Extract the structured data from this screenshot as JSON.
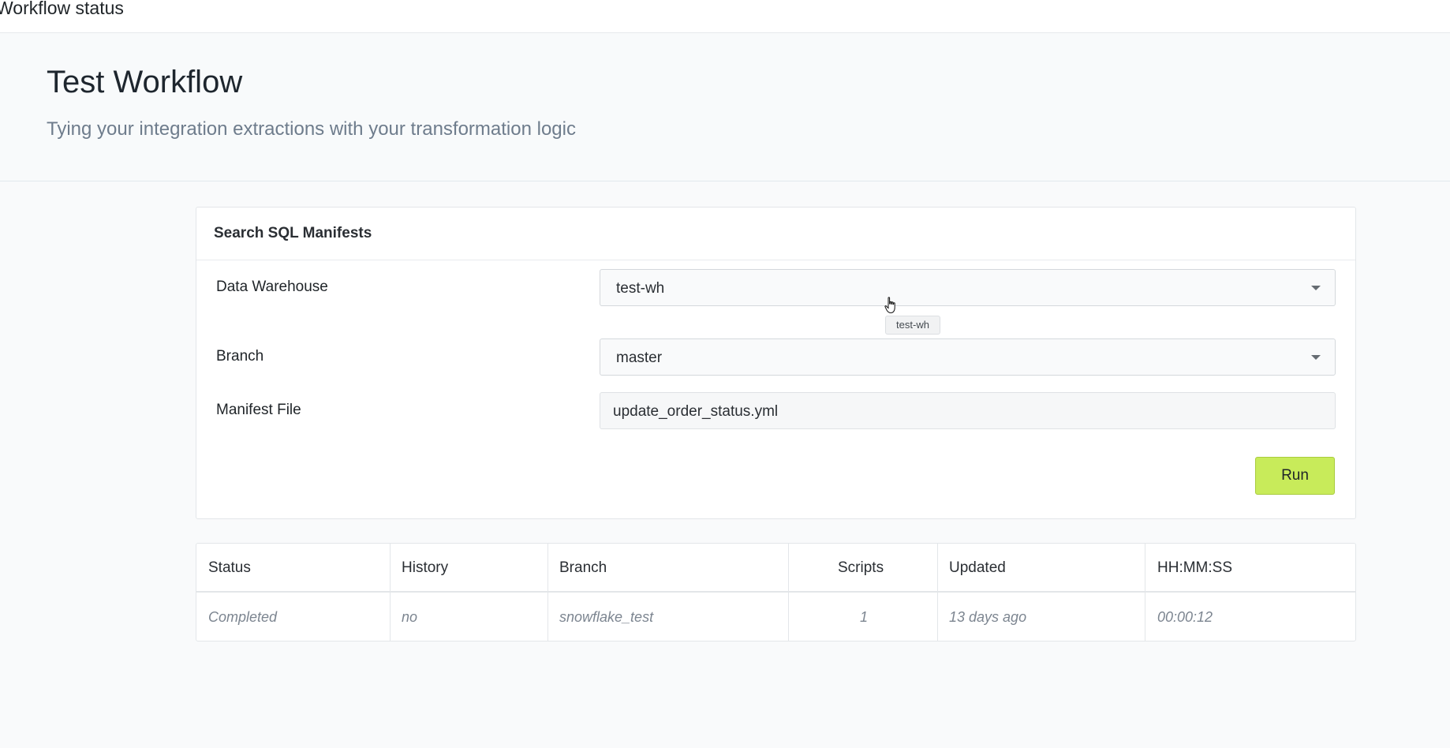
{
  "topbar": {
    "title": "Workflow status"
  },
  "hero": {
    "title": "Test Workflow",
    "subtitle": "Tying your integration extractions with your transformation logic"
  },
  "card": {
    "header": "Search SQL Manifests",
    "fields": {
      "warehouse": {
        "label": "Data Warehouse",
        "value": "test-wh"
      },
      "branch": {
        "label": "Branch",
        "value": "master"
      },
      "manifest": {
        "label": "Manifest File",
        "value": "update_order_status.yml"
      }
    },
    "run_label": "Run",
    "tooltip": "test-wh"
  },
  "table": {
    "columns": [
      "Status",
      "History",
      "Branch",
      "Scripts",
      "Updated",
      "HH:MM:SS"
    ],
    "rows": [
      [
        "Completed",
        "no",
        "snowflake_test",
        "1",
        "13 days ago",
        "00:00:12"
      ]
    ]
  },
  "colors": {
    "accent": "#c8eb5a",
    "background": "#f9fafb"
  },
  "icons": {
    "select_caret": "chevron-down-icon",
    "cursor": "hand-pointer-icon"
  }
}
